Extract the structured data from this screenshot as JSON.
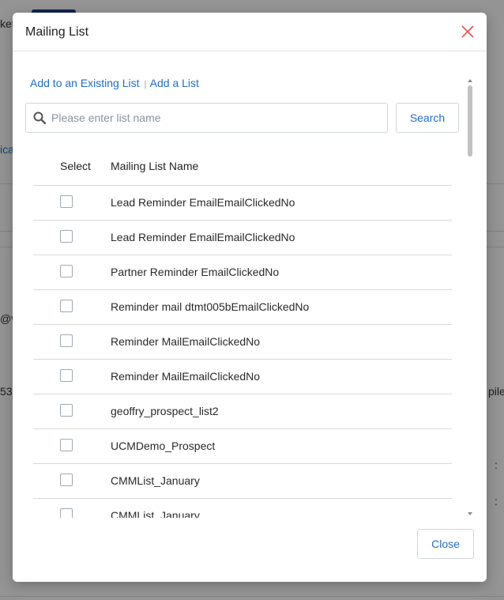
{
  "background": {
    "fragments": [
      "ket",
      "ica",
      "@vo",
      "53",
      "pile",
      ":",
      ":"
    ]
  },
  "modal": {
    "title": "Mailing List",
    "links": {
      "existing": "Add to an Existing List",
      "separator": "|",
      "add": "Add a List"
    },
    "search": {
      "placeholder": "Please enter list name",
      "value": "",
      "button_label": "Search"
    },
    "table": {
      "headers": {
        "select": "Select",
        "name": "Mailing List Name"
      },
      "rows": [
        {
          "name": "Lead Reminder EmailEmailClickedNo",
          "checked": false
        },
        {
          "name": "Lead Reminder EmailEmailClickedNo",
          "checked": false
        },
        {
          "name": "Partner Reminder EmailClickedNo",
          "checked": false
        },
        {
          "name": "Reminder mail dtmt005bEmailClickedNo",
          "checked": false
        },
        {
          "name": "Reminder MailEmailClickedNo",
          "checked": false
        },
        {
          "name": "Reminder MailEmailClickedNo",
          "checked": false
        },
        {
          "name": "geoffry_prospect_list2",
          "checked": false
        },
        {
          "name": "UCMDemo_Prospect",
          "checked": false
        },
        {
          "name": "CMMList_January",
          "checked": false
        },
        {
          "name": "CMMList_January",
          "checked": false
        }
      ]
    },
    "footer": {
      "close_label": "Close"
    }
  },
  "colors": {
    "accent": "#1f6fc5",
    "close_x": "#e0564f",
    "border": "#cfd6de"
  }
}
